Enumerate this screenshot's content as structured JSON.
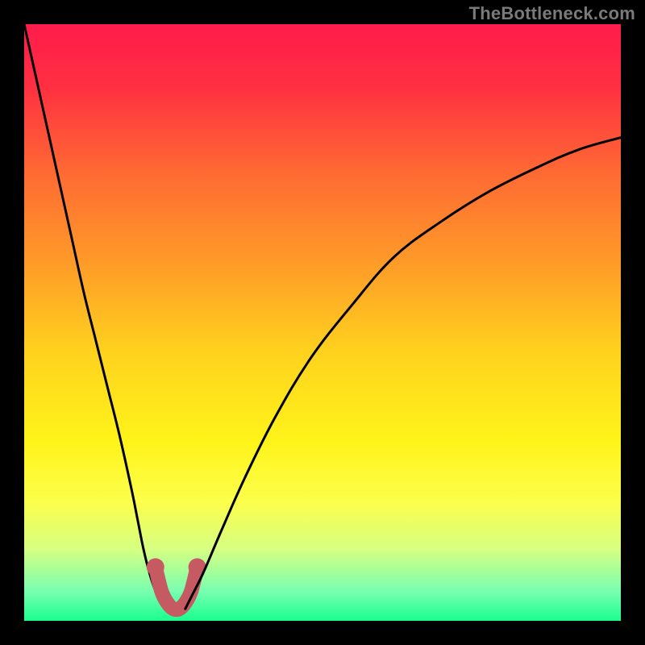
{
  "watermark": "TheBottleneck.com",
  "chart_data": {
    "type": "line",
    "title": "",
    "xlabel": "",
    "ylabel": "",
    "xlim": [
      0,
      100
    ],
    "ylim": [
      0,
      100
    ],
    "background_gradient_stops": [
      {
        "pos": 0.0,
        "color": "#ff1c4b"
      },
      {
        "pos": 0.1,
        "color": "#ff2e42"
      },
      {
        "pos": 0.25,
        "color": "#ff6a33"
      },
      {
        "pos": 0.4,
        "color": "#ff9b28"
      },
      {
        "pos": 0.55,
        "color": "#ffd21e"
      },
      {
        "pos": 0.7,
        "color": "#fff41a"
      },
      {
        "pos": 0.8,
        "color": "#fcff4b"
      },
      {
        "pos": 0.88,
        "color": "#d6ff82"
      },
      {
        "pos": 0.95,
        "color": "#79ffb0"
      },
      {
        "pos": 1.0,
        "color": "#19ff8e"
      }
    ],
    "series": [
      {
        "name": "left-curve",
        "x": [
          0,
          2,
          4,
          6,
          8,
          10,
          12,
          14,
          16,
          18,
          19,
          20,
          21,
          22,
          23,
          24
        ],
        "y": [
          100,
          91,
          82,
          73,
          64,
          55,
          47,
          39,
          31,
          22,
          17,
          12,
          8,
          5,
          3,
          2
        ]
      },
      {
        "name": "trough-marker",
        "x": [
          22,
          23,
          24,
          25,
          26,
          27,
          28,
          29
        ],
        "y": [
          9,
          5,
          3,
          2,
          2,
          3,
          5,
          9
        ],
        "style": "thick-muted-red"
      },
      {
        "name": "right-curve",
        "x": [
          27,
          28,
          30,
          33,
          37,
          42,
          48,
          55,
          62,
          70,
          78,
          86,
          93,
          100
        ],
        "y": [
          2,
          4,
          8,
          15,
          24,
          34,
          44,
          53,
          61,
          67,
          72,
          76,
          79,
          81
        ]
      }
    ]
  }
}
